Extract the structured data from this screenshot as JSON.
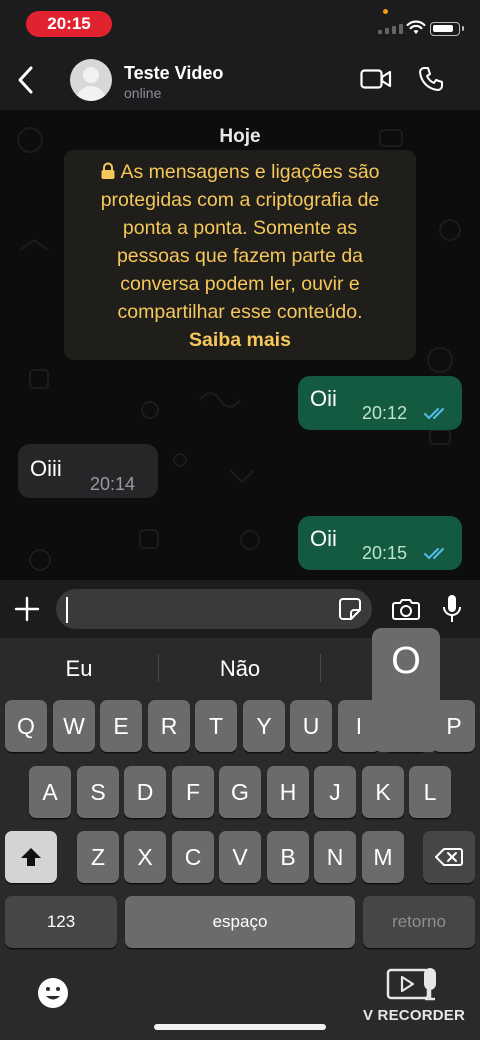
{
  "status_bar": {
    "time": "20:15"
  },
  "header": {
    "contact_name": "Teste Video",
    "contact_status": "online"
  },
  "chat": {
    "date_label": "Hoje",
    "encryption_notice": {
      "lines": [
        "As mensagens e ligações são",
        "protegidas com a criptografia de",
        "ponta a ponta. Somente as",
        "pessoas que fazem parte da",
        "conversa podem ler, ouvir e",
        "compartilhar esse conteúdo."
      ],
      "link": "Saiba mais"
    },
    "messages": [
      {
        "direction": "out",
        "text": "Oii",
        "time": "20:12",
        "status": "read"
      },
      {
        "direction": "in",
        "text": "Oiii",
        "time": "20:14"
      },
      {
        "direction": "out",
        "text": "Oii",
        "time": "20:15",
        "status": "read"
      }
    ],
    "colors": {
      "outgoing": "#145a40",
      "incoming": "#262628",
      "notice_text": "#f6c75a",
      "read_ticks": "#53bdeb"
    }
  },
  "input": {
    "value": ""
  },
  "keyboard": {
    "suggestions": [
      "Eu",
      "Não",
      ""
    ],
    "popup_key": "O",
    "row1": [
      "Q",
      "W",
      "E",
      "R",
      "T",
      "Y",
      "U",
      "I",
      "O",
      "P"
    ],
    "row2": [
      "A",
      "S",
      "D",
      "F",
      "G",
      "H",
      "J",
      "K",
      "L"
    ],
    "row3": [
      "Z",
      "X",
      "C",
      "V",
      "B",
      "N",
      "M"
    ],
    "numbers_key": "123",
    "space_key": "espaço",
    "return_key": "retorno"
  },
  "watermark": {
    "label": "V RECORDER"
  }
}
